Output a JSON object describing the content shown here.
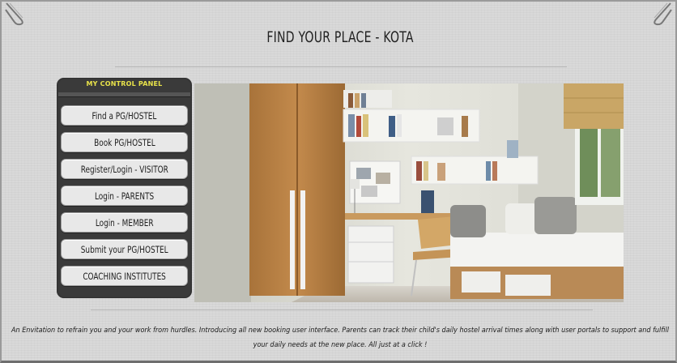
{
  "page": {
    "title": "FIND YOUR PLACE - KOTA",
    "description": "An Envitation to refrain you and your work from hurdles. Introducing all new booking user interface. Parents can track their child's daily hostel arrival times along with user portals to support and fulfill your daily needs at the new place. All just at a click !"
  },
  "control_panel": {
    "title": "MY CONTROL PANEL",
    "items": [
      {
        "label": "Find a PG/HOSTEL"
      },
      {
        "label": "Book PG/HOSTEL"
      },
      {
        "label": "Register/Login - VISITOR"
      },
      {
        "label": "Login - PARENTS"
      },
      {
        "label": "Login - MEMBER"
      },
      {
        "label": "Submit your PG/HOSTEL"
      },
      {
        "label": "COACHING INSTITUTES"
      }
    ]
  },
  "colors": {
    "panel_bg": "#3a3a3a",
    "panel_title": "#e8e24a",
    "button_bg": "#e8e8e8",
    "page_bg": "#d9d9d9"
  },
  "icons": {
    "corner_left": "paperclip-icon",
    "corner_right": "paperclip-icon"
  }
}
